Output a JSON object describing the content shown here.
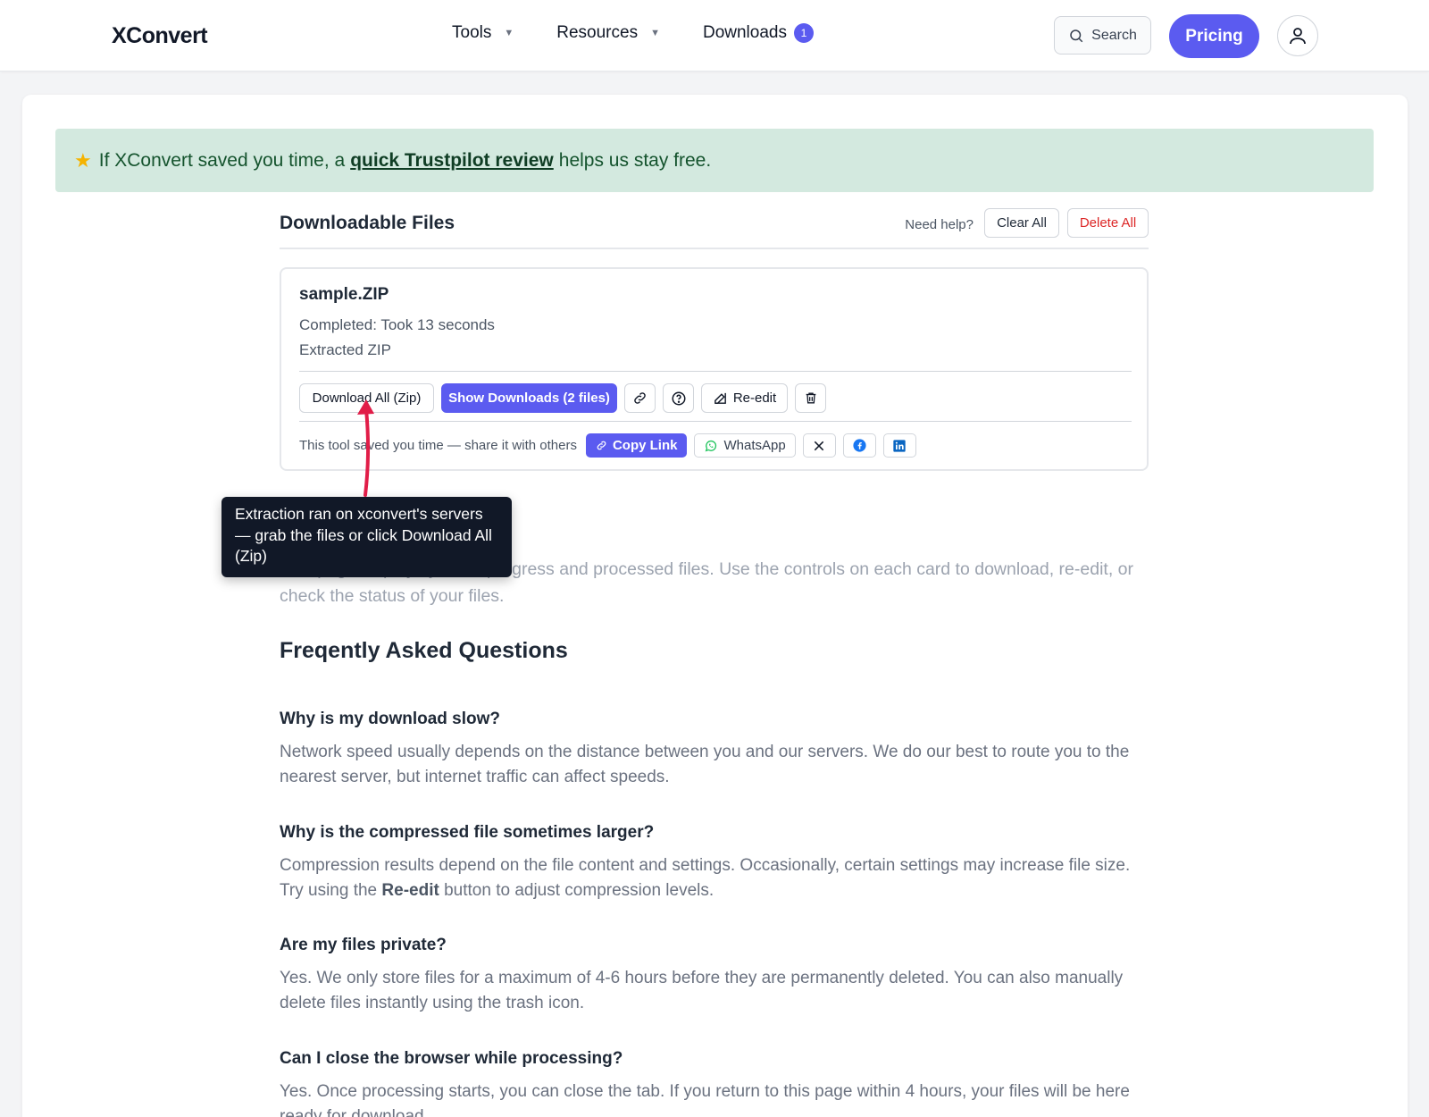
{
  "header": {
    "logo": "XConvert",
    "nav": [
      {
        "label": "Tools"
      },
      {
        "label": "Resources"
      },
      {
        "label": "Downloads",
        "badge": "1"
      }
    ],
    "search_label": "Search",
    "pricing_label": "Pricing"
  },
  "banner": {
    "prefix": "If XConvert saved you time, a",
    "link": "quick Trustpilot review",
    "suffix": "helps us stay free."
  },
  "downloads": {
    "title": "Downloadable Files",
    "need_help": "Need help?",
    "clear_all": "Clear All",
    "delete_all": "Delete All"
  },
  "file": {
    "name": "sample.ZIP",
    "status": "Completed: Took 13 seconds",
    "subtitle": "Extracted ZIP",
    "download_all": "Download All (Zip)",
    "show_downloads": "Show Downloads (2 files)",
    "reedit": "Re-edit",
    "share_text": "This tool saved you time — share it with others",
    "copy_link": "Copy Link",
    "whatsapp": "WhatsApp"
  },
  "intro": "This page displays your in-progress and processed files. Use the controls on each card to download, re-edit, or check the status of your files.",
  "faq": {
    "title": "Freqently Asked Questions",
    "items": [
      {
        "q": "Why is my download slow?",
        "a": "Network speed usually depends on the distance between you and our servers. We do our best to route you to the nearest server, but internet traffic can affect speeds."
      },
      {
        "q": "Why is the compressed file sometimes larger?",
        "a_pre": "Compression results depend on the file content and settings. Occasionally, certain settings may increase file size. Try using the",
        "a_bold": "Re-edit",
        "a_post": "button to adjust compression levels."
      },
      {
        "q": "Are my files private?",
        "a": "Yes. We only store files for a maximum of 4-6 hours before they are permanently deleted. You can also manually delete files instantly using the trash icon."
      },
      {
        "q": "Can I close the browser while processing?",
        "a": "Yes. Once processing starts, you can close the tab. If you return to this page within 4 hours, your files will be here ready for download."
      }
    ]
  },
  "tooltip": {
    "text": "Extraction ran on xconvert's servers — grab the files or click Download All (Zip)"
  },
  "colors": {
    "accent": "#5b5bf0",
    "banner_bg": "#d3e9df",
    "danger": "#dc2626",
    "annotation_arrow": "#e11d48"
  }
}
